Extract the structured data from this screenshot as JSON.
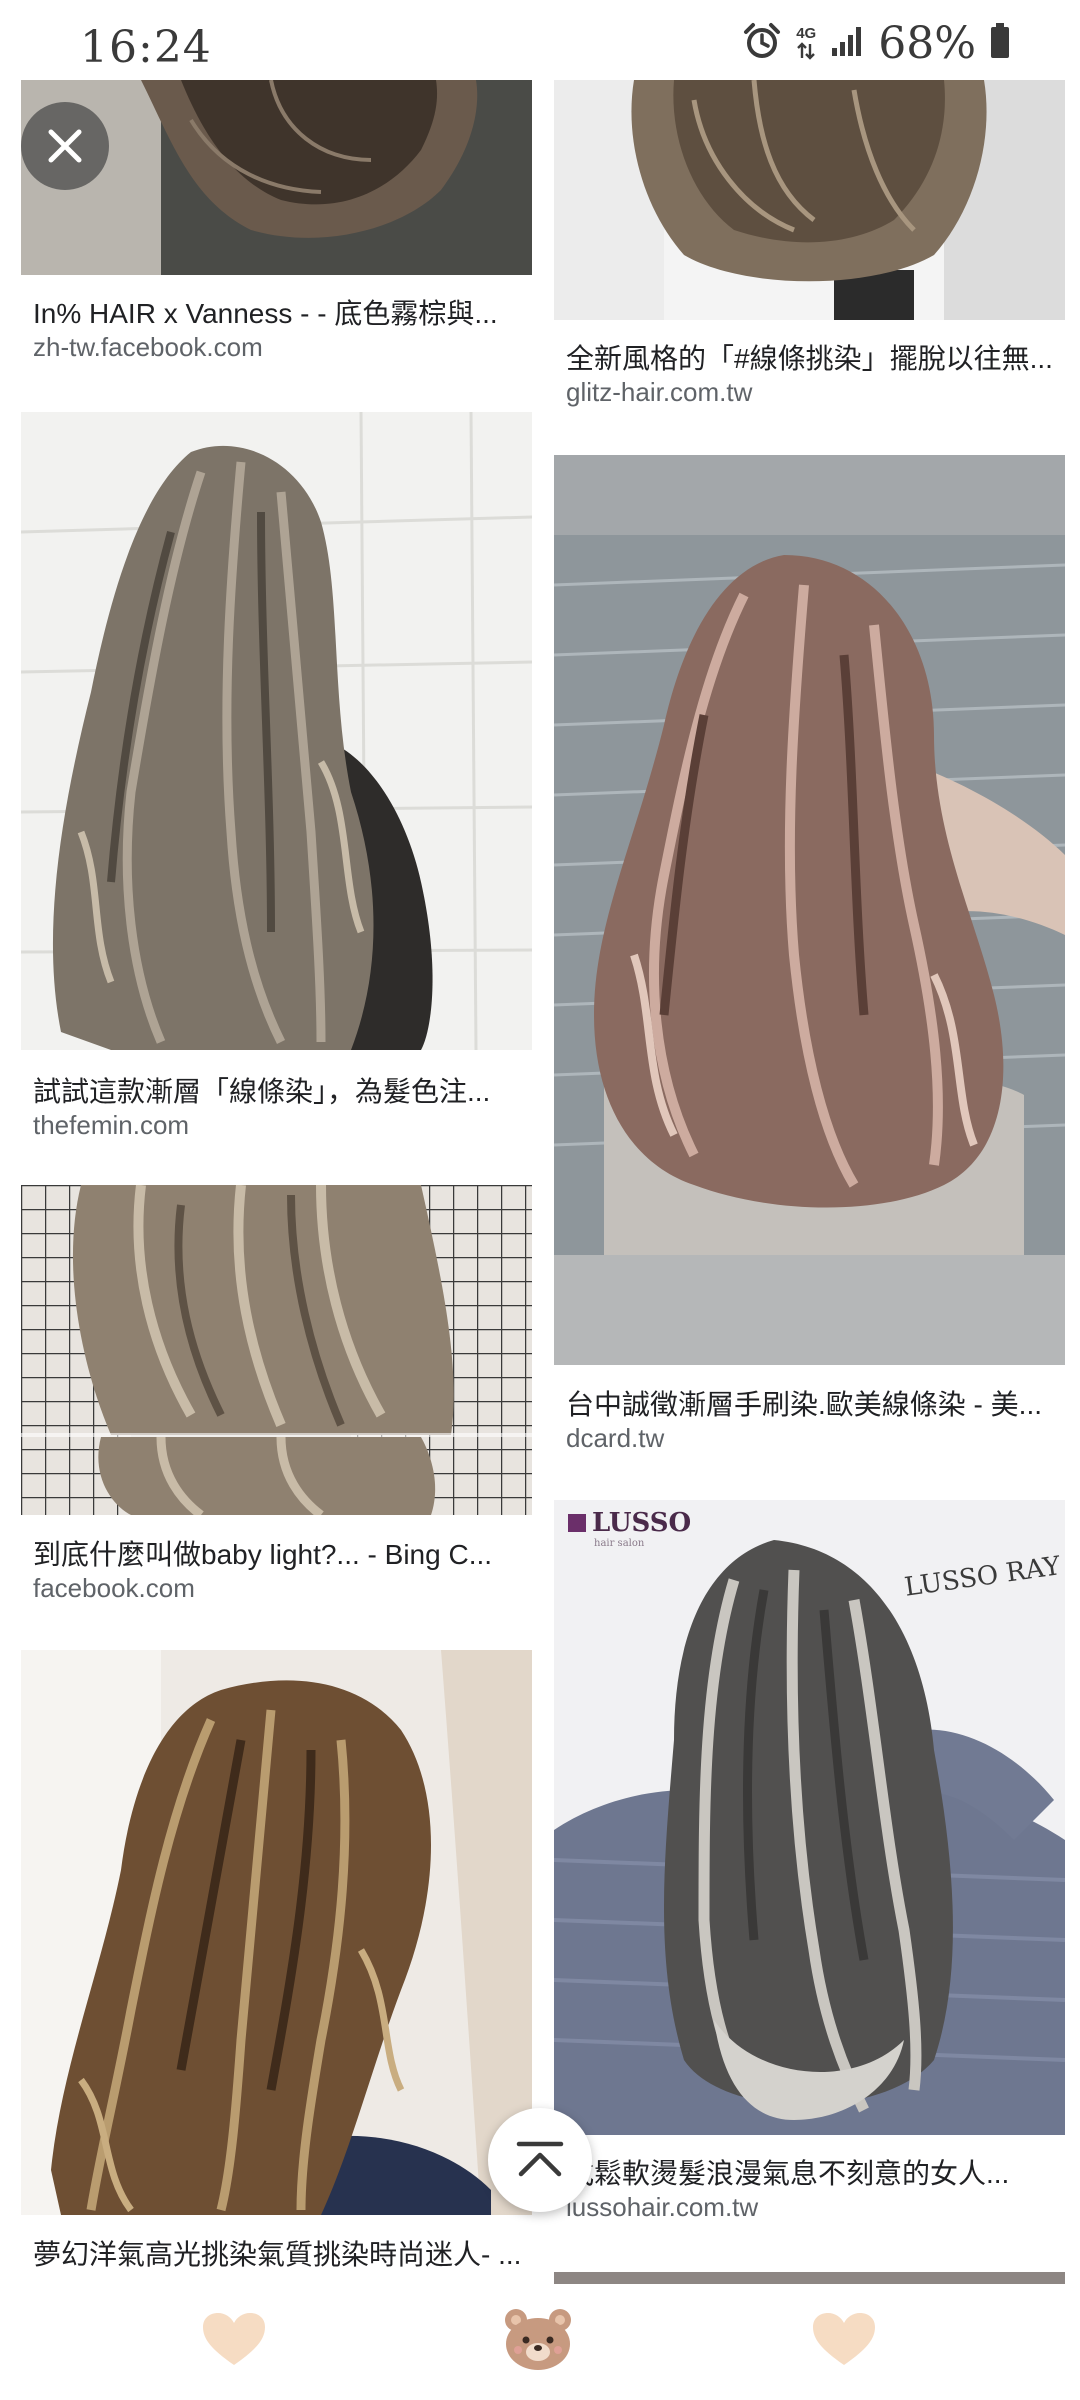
{
  "status_bar": {
    "time": "16:24",
    "network": "4G",
    "battery": "68%",
    "icons": [
      "alarm-icon",
      "network-4g-icon",
      "signal-icon",
      "battery-icon"
    ]
  },
  "close_button": {
    "icon": "close-icon"
  },
  "results": [
    {
      "title": "In% HAIR x Vanness - - 底色霧棕與...",
      "source": "zh-tw.facebook.com"
    },
    {
      "title": "全新風格的「#線條挑染」擺脫以往無...",
      "source": "glitz-hair.com.tw"
    },
    {
      "title": "試試這款漸層「線條染」，為髮色注...",
      "source": "thefemin.com"
    },
    {
      "title": "台中誠徵漸層手刷染.歐美線條染 - 美...",
      "source": "dcard.tw"
    },
    {
      "title": "到底什麼叫做baby light?... - Bing C...",
      "source": "facebook.com"
    },
    {
      "title": "式鬆軟燙髮浪漫氣息不刻意的女人...",
      "source": "lussohair.com.tw"
    },
    {
      "title": "夢幻洋氣高光挑染氣質挑染時尚迷人- ...",
      "source": ""
    }
  ],
  "image_overlay_text": {
    "lusso_logo": "LUSSO",
    "lusso_sub": "hair salon",
    "lusso_ray": "LUSSO RAY"
  },
  "scroll_top_button": {
    "icon": "chevron-up-icon"
  },
  "bottom_bar": {
    "icons": [
      "heart-icon",
      "bear-face-icon",
      "heart-icon"
    ]
  },
  "colors": {
    "text_primary": "#202124",
    "text_secondary": "#5f6368",
    "heart": "#f6dcc3",
    "bear": "#c79a80"
  }
}
